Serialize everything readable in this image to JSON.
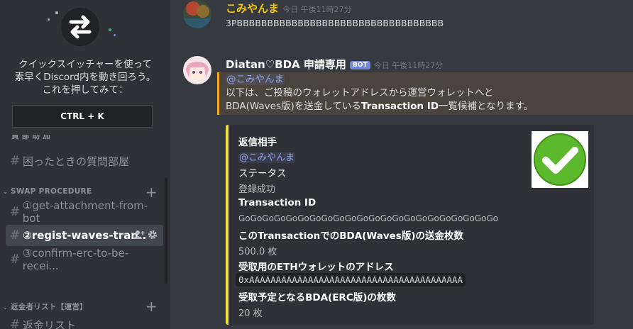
{
  "sidebar": {
    "switcher_text": [
      "クイックスイッチャーを使って",
      "素早くDiscord内を動き回ろう。",
      "これを押してみて："
    ],
    "shortcut": "CTRL + K",
    "partial_category": "買 部 助 加",
    "channels": [
      {
        "name": "困ったときの質問部屋",
        "active": false
      }
    ],
    "category_swap": "SWAP PROCEDURE",
    "swap_channels": [
      {
        "name": "①get-attachment-from-bot",
        "active": false
      },
      {
        "name": "②regist-waves-tran..",
        "active": true
      },
      {
        "name": "③confirm-erc-to-be-recei...",
        "active": false
      }
    ],
    "category_refund": "返金者リスト【運営】",
    "refund_channel": "返金リスト"
  },
  "messages": [
    {
      "author": "こみやんま",
      "author_color": "#f1c40f",
      "timestamp": "今日 午後11時27分",
      "text": "3PBBBBBBBBBBBBBBBBBBBBBBBBBBBBBBBBBB"
    },
    {
      "author": "Diatan♡BDA 申請専用",
      "author_color": "#ffffff",
      "badge": "BOT",
      "timestamp": "今日 午後11時27分",
      "mention": "@こみやんま",
      "line1": "以下は、ご投稿のウォレットアドレスから運営ウォレットへと",
      "line2_pre": "BDA(Waves版)を送金している",
      "line2_bold": "Transaction ID",
      "line2_post": "一覧候補となります。",
      "embed": {
        "accent": "#f1e23a",
        "fields": [
          {
            "name": "返信相手",
            "value": "@こみやんま",
            "mention": true
          },
          {
            "name": "ステータス",
            "value": "登録成功"
          },
          {
            "name": "Transaction ID",
            "value": "GoGoGoGoGoGoGoGoGoGoGoGoGoGoGoGoGoGoGoGoGoGo"
          },
          {
            "name": "このTransactionでのBDA(Waves版)の送金枚数",
            "value": "500.0 枚"
          },
          {
            "name": "受取用のETHウォレットのアドレス",
            "value": "0xAAAAAAAAAAAAAAAAAAAAAAAAAAAAAAAAAAAAAAAA",
            "code": true
          },
          {
            "name": "受取予定となるBDA(ERC版)の枚数",
            "value": "20 枚"
          }
        ]
      }
    }
  ],
  "colors": {
    "background": "#36393f",
    "sidebar": "#2f3136",
    "mention_bar": "#faa61a",
    "check_green": "#5cb82c"
  }
}
